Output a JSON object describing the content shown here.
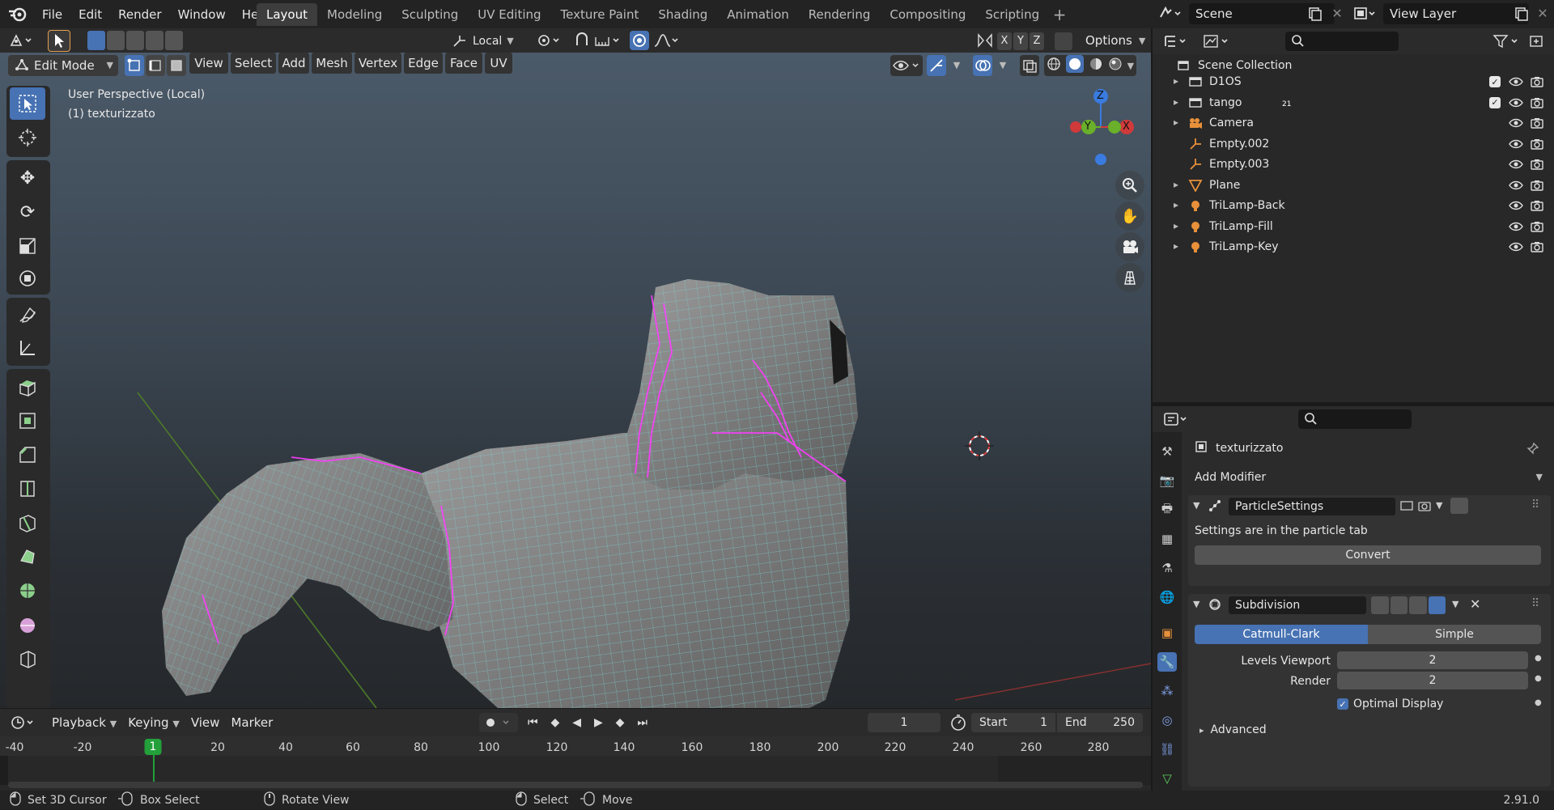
{
  "menubar": {
    "items": [
      "File",
      "Edit",
      "Render",
      "Window",
      "Help"
    ]
  },
  "workspaces": {
    "tabs": [
      "Layout",
      "Modeling",
      "Sculpting",
      "UV Editing",
      "Texture Paint",
      "Shading",
      "Animation",
      "Rendering",
      "Compositing",
      "Scripting"
    ],
    "active": "Layout",
    "add_label": "+"
  },
  "scene": {
    "name": "Scene",
    "view_layer": "View Layer"
  },
  "viewport_header": {
    "transform_orientation": "Local",
    "axes": [
      "X",
      "Y",
      "Z"
    ],
    "options_label": "Options",
    "mode": "Edit Mode",
    "menus": [
      "View",
      "Select",
      "Add",
      "Mesh",
      "Vertex",
      "Edge",
      "Face",
      "UV"
    ]
  },
  "viewport": {
    "perspective_label": "User Perspective (Local)",
    "object_label": "(1) texturizzato",
    "gizmo_axes": {
      "z": "Z",
      "y": "Y",
      "x": "X"
    }
  },
  "timeline": {
    "menus": [
      "Playback",
      "Keying",
      "View",
      "Marker"
    ],
    "current_frame": "1",
    "start_label": "Start",
    "start_value": "1",
    "end_label": "End",
    "end_value": "250",
    "ticks": [
      "-40",
      "-20",
      "1",
      "20",
      "40",
      "60",
      "80",
      "100",
      "120",
      "140",
      "160",
      "180",
      "200",
      "220",
      "240",
      "260",
      "280"
    ]
  },
  "statusbar": {
    "items": [
      "Set 3D Cursor",
      "Box Select",
      "Rotate View",
      "Select",
      "Move"
    ],
    "version": "2.91.0"
  },
  "outliner": {
    "root": "Scene Collection",
    "items": [
      {
        "name": "D1OS",
        "icon": "collection-icon",
        "expand": "▸",
        "has_checkbox": true
      },
      {
        "name": "tango",
        "icon": "collection-icon",
        "expand": "▸",
        "has_checkbox": true,
        "badge": "21"
      },
      {
        "name": "Camera",
        "icon": "camera-icon",
        "expand": "▸",
        "has_checkbox": false
      },
      {
        "name": "Empty.002",
        "icon": "empty-icon",
        "expand": "",
        "has_checkbox": false
      },
      {
        "name": "Empty.003",
        "icon": "empty-icon",
        "expand": "",
        "has_checkbox": false
      },
      {
        "name": "Plane",
        "icon": "mesh-icon",
        "expand": "▸",
        "has_checkbox": false
      },
      {
        "name": "TriLamp-Back",
        "icon": "light-icon",
        "expand": "▸",
        "has_checkbox": false
      },
      {
        "name": "TriLamp-Fill",
        "icon": "light-icon",
        "expand": "▸",
        "has_checkbox": false
      },
      {
        "name": "TriLamp-Key",
        "icon": "light-icon",
        "expand": "▸",
        "has_checkbox": false
      }
    ]
  },
  "properties": {
    "object_name": "texturizzato",
    "add_modifier_label": "Add Modifier",
    "particle": {
      "name": "ParticleSettings",
      "message": "Settings are in the particle tab",
      "convert_label": "Convert"
    },
    "subdivision": {
      "name": "Subdivision",
      "mode_catmull": "Catmull-Clark",
      "mode_simple": "Simple",
      "levels_viewport_label": "Levels Viewport",
      "levels_viewport_value": "2",
      "render_label": "Render",
      "render_value": "2",
      "optimal_display_label": "Optimal Display",
      "advanced_label": "Advanced"
    }
  },
  "colors": {
    "accent": "#4772b3",
    "selected_vertex": "#ff3cff",
    "wire": "#66e0e0",
    "frame_marker": "#23a03a"
  }
}
